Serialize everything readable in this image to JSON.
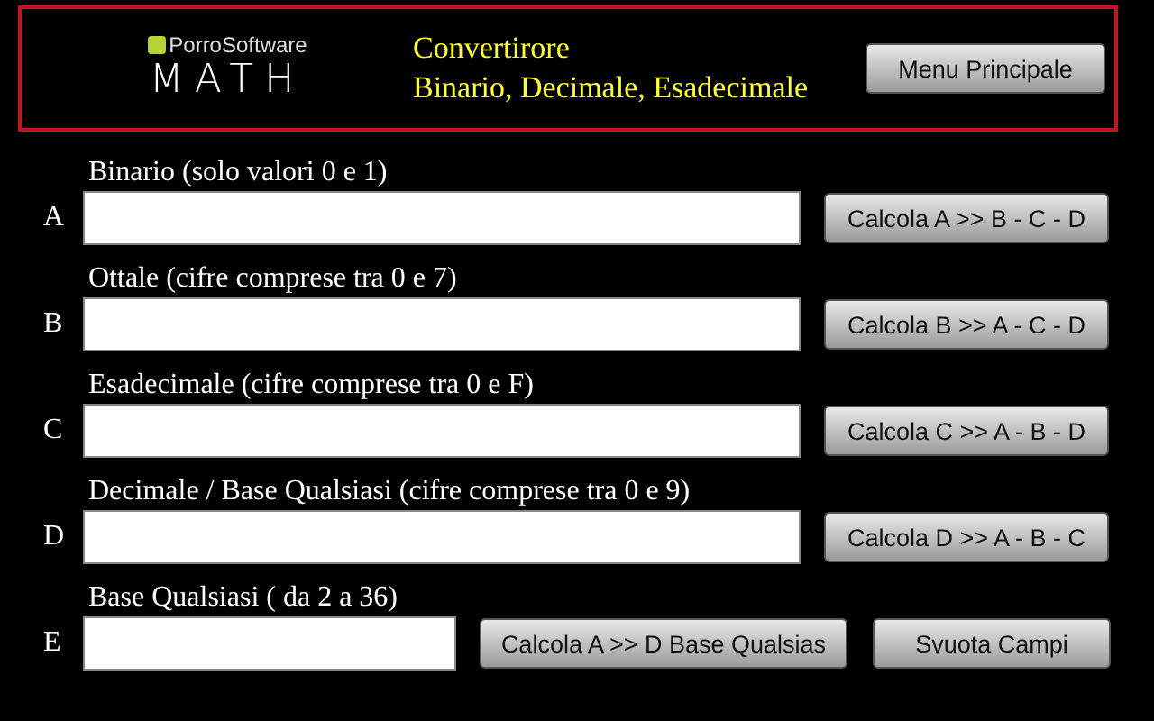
{
  "header": {
    "logo_brand": "PorroSoftware",
    "logo_word": "MATH",
    "title_lines": [
      "Convertirore",
      "Binario, Decimale, Esadecimale"
    ],
    "menu_button": "Menu Principale"
  },
  "rows": [
    {
      "letter": "A",
      "label": "Binario (solo valori 0 e 1)",
      "buttons": [
        "Calcola A >> B - C - D"
      ]
    },
    {
      "letter": "B",
      "label": "Ottale (cifre comprese tra 0 e 7)",
      "buttons": [
        "Calcola B >> A - C - D"
      ]
    },
    {
      "letter": "C",
      "label": "Esadecimale (cifre comprese tra 0 e F)",
      "buttons": [
        "Calcola C >> A - B - D"
      ]
    },
    {
      "letter": "D",
      "label": "Decimale / Base Qualsiasi (cifre comprese tra 0 e 9)",
      "buttons": [
        "Calcola D >> A - B - C"
      ]
    },
    {
      "letter": "E",
      "label": "Base Qualsiasi ( da 2 a 36)",
      "buttons": [
        "Calcola A >> D Base Qualsias",
        "Svuota Campi"
      ]
    }
  ]
}
